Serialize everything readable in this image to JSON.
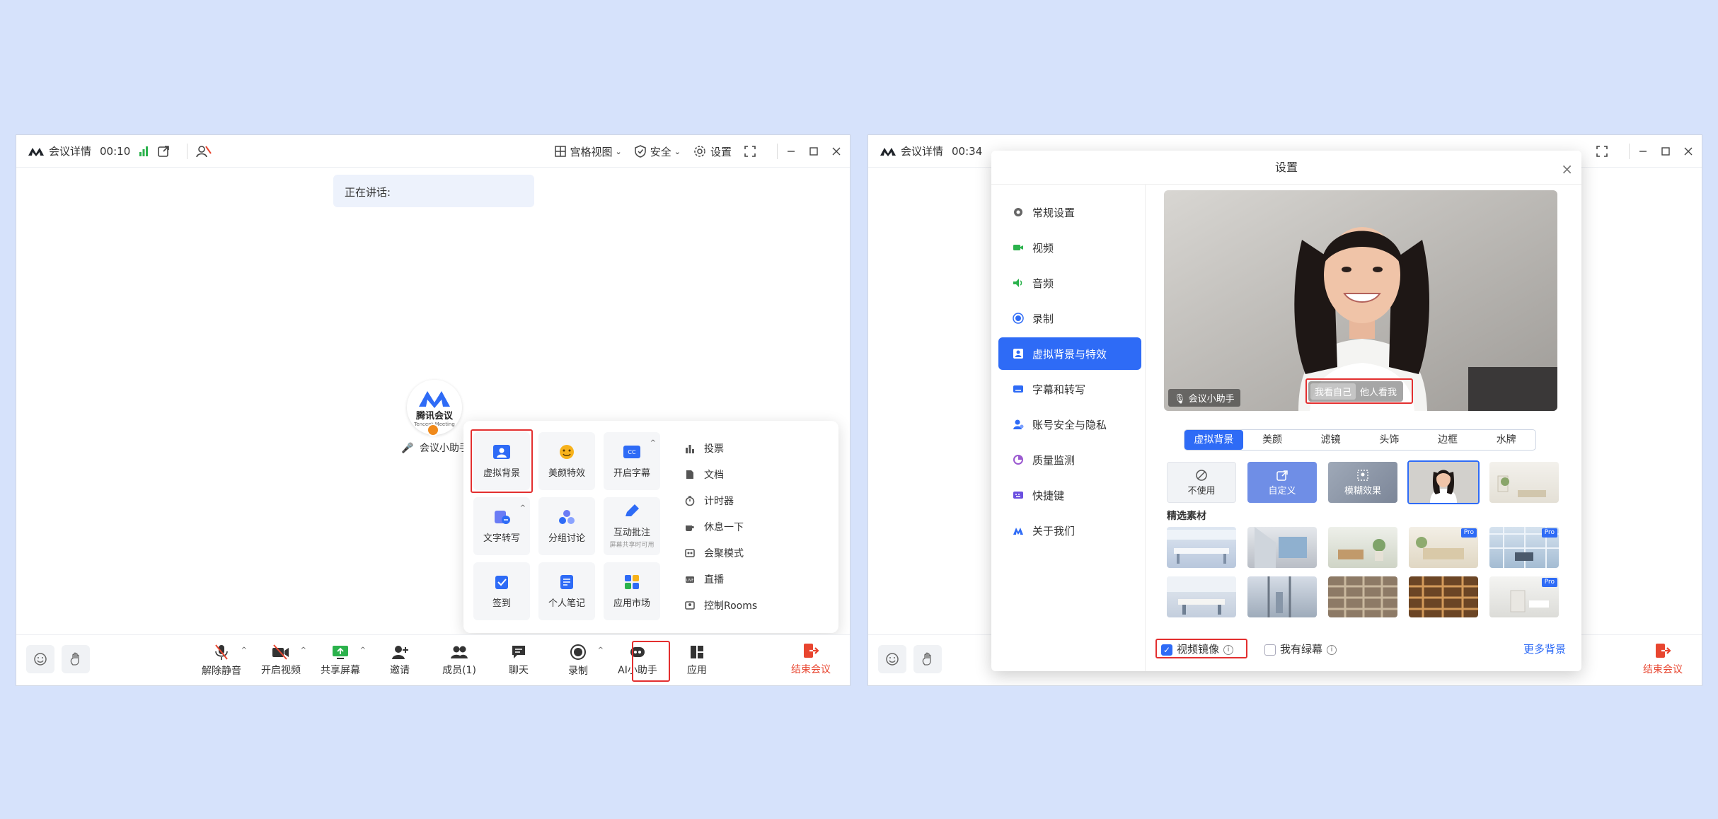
{
  "left_window": {
    "titlebar": {
      "meeting_details": "会议详情",
      "timer": "00:10",
      "view_mode": "宫格视图",
      "security": "安全",
      "settings": "设置"
    },
    "speaking_label": "正在讲话:",
    "participant": {
      "logo_text": "腾讯会议",
      "logo_subtext": "Tencent Meeting",
      "name": "会议小助手"
    },
    "app_panel": {
      "grid": [
        {
          "label": "虚拟背景",
          "icon": "virtual-background-icon",
          "highlighted": true
        },
        {
          "label": "美颜特效",
          "icon": "beauty-effect-icon"
        },
        {
          "label": "开启字幕",
          "icon": "captions-icon",
          "caret": true
        },
        {
          "label": "文字转写",
          "icon": "transcription-icon",
          "caret": true
        },
        {
          "label": "分组讨论",
          "icon": "breakout-rooms-icon"
        },
        {
          "label": "互动批注",
          "icon": "annotate-icon",
          "sub": "屏幕共享时可用"
        },
        {
          "label": "签到",
          "icon": "checkin-icon"
        },
        {
          "label": "个人笔记",
          "icon": "notes-icon"
        },
        {
          "label": "应用市场",
          "icon": "app-market-icon"
        }
      ],
      "list": [
        {
          "label": "投票",
          "icon": "poll-icon"
        },
        {
          "label": "文档",
          "icon": "document-icon"
        },
        {
          "label": "计时器",
          "icon": "timer-icon"
        },
        {
          "label": "休息一下",
          "icon": "break-icon"
        },
        {
          "label": "会聚模式",
          "icon": "together-mode-icon"
        },
        {
          "label": "直播",
          "icon": "live-icon"
        },
        {
          "label": "控制Rooms",
          "icon": "rooms-icon"
        }
      ]
    },
    "toolbar": {
      "unmute": "解除静音",
      "start_video": "开启视频",
      "share_screen": "共享屏幕",
      "invite": "邀请",
      "members": "成员(1)",
      "chat": "聊天",
      "record": "录制",
      "ai_assistant": "AI小助手",
      "apps": "应用",
      "end_meeting": "结束会议"
    }
  },
  "right_window": {
    "titlebar": {
      "meeting_details": "会议详情",
      "timer": "00:34"
    },
    "settings_dialog": {
      "title": "设置",
      "nav": [
        {
          "label": "常规设置",
          "icon": "gear-icon",
          "color": "#666666"
        },
        {
          "label": "视频",
          "icon": "video-icon",
          "color": "#2bb24c"
        },
        {
          "label": "音频",
          "icon": "audio-icon",
          "color": "#2bb24c"
        },
        {
          "label": "录制",
          "icon": "record-icon",
          "color": "#2e6bf6"
        },
        {
          "label": "虚拟背景与特效",
          "icon": "virtual-background-icon",
          "color": "#2e6bf6",
          "active": true
        },
        {
          "label": "字幕和转写",
          "icon": "captions-icon",
          "color": "#2e6bf6"
        },
        {
          "label": "账号安全与隐私",
          "icon": "account-icon",
          "color": "#2e6bf6"
        },
        {
          "label": "质量监测",
          "icon": "quality-icon",
          "color": "#9b59d0"
        },
        {
          "label": "快捷键",
          "icon": "shortcut-icon",
          "color": "#6a4fe0"
        },
        {
          "label": "关于我们",
          "icon": "about-icon",
          "color": "#2e6bf6"
        }
      ],
      "preview": {
        "name_tag": "会议小助手",
        "view_self": "我看自己",
        "view_others": "他人看我"
      },
      "tabs": [
        "虚拟背景",
        "美颜",
        "滤镜",
        "头饰",
        "边框",
        "水牌"
      ],
      "active_tab": "虚拟背景",
      "first_row": [
        {
          "label": "不使用",
          "icon": "none-icon"
        },
        {
          "label": "自定义",
          "icon": "custom-upload-icon"
        },
        {
          "label": "模糊效果",
          "icon": "blur-icon"
        }
      ],
      "featured_title": "精选素材",
      "pro_badge": "Pro",
      "footer": {
        "mirror_label": "视频镜像",
        "mirror_checked": true,
        "green_screen_label": "我有绿幕",
        "green_screen_checked": false,
        "more_backgrounds": "更多背景"
      }
    }
  },
  "colors": {
    "page_bg": "#d6e2fb",
    "accent": "#2e6bf6",
    "end_red": "#e8452f",
    "highlight_red": "#e32f2f"
  }
}
